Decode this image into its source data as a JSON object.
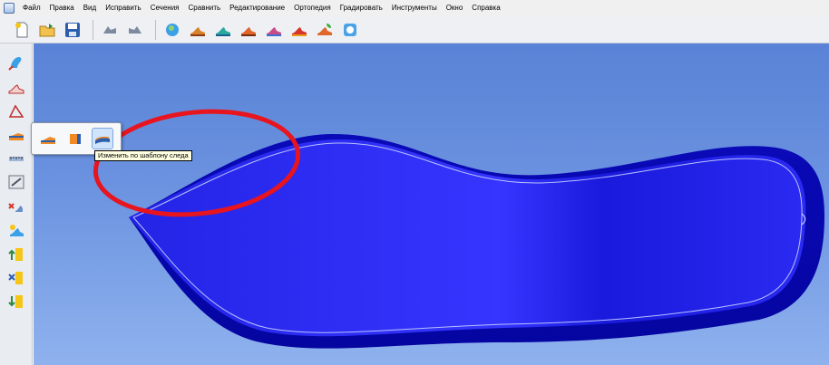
{
  "menu": {
    "items": [
      "Файл",
      "Правка",
      "Вид",
      "Исправить",
      "Сечения",
      "Сравнить",
      "Редактирование",
      "Ортопедия",
      "Градировать",
      "Инструменты",
      "Окно",
      "Справка"
    ]
  },
  "toolbar": {
    "buttons": [
      "new-file-icon",
      "open-folder-icon",
      "save-icon",
      "undo-icon",
      "redo-icon",
      "shoe-view-icon",
      "shoe-red-icon",
      "shoe-teal-icon",
      "shoe-orange-icon",
      "shoe-multi-icon",
      "shoe-red2-icon",
      "shoe-leaf-icon",
      "shoe-blue-icon"
    ]
  },
  "sidebar": {
    "tools": [
      "foot-tool-icon",
      "shoe-outline-icon",
      "outline-triangle-icon",
      "insole-edit-icon",
      "scale-tool-icon",
      "measure-tool-icon",
      "delete-tool-icon",
      "paint-tool-icon",
      "grade-up-icon",
      "grade-x-icon",
      "grade-down-icon"
    ]
  },
  "popup": {
    "buttons": [
      "insole-left-icon",
      "insole-block-icon",
      "insole-template-icon"
    ],
    "active": "insole-template-icon"
  },
  "tooltip": {
    "text": "Изменить по шаблону следа"
  },
  "colors": {
    "canvas_top": "#5a82d6",
    "canvas_bottom": "#8fb2ee",
    "insole_dark": "#1010d8",
    "insole_light": "#3a3aff",
    "annotation": "#e8141e"
  }
}
